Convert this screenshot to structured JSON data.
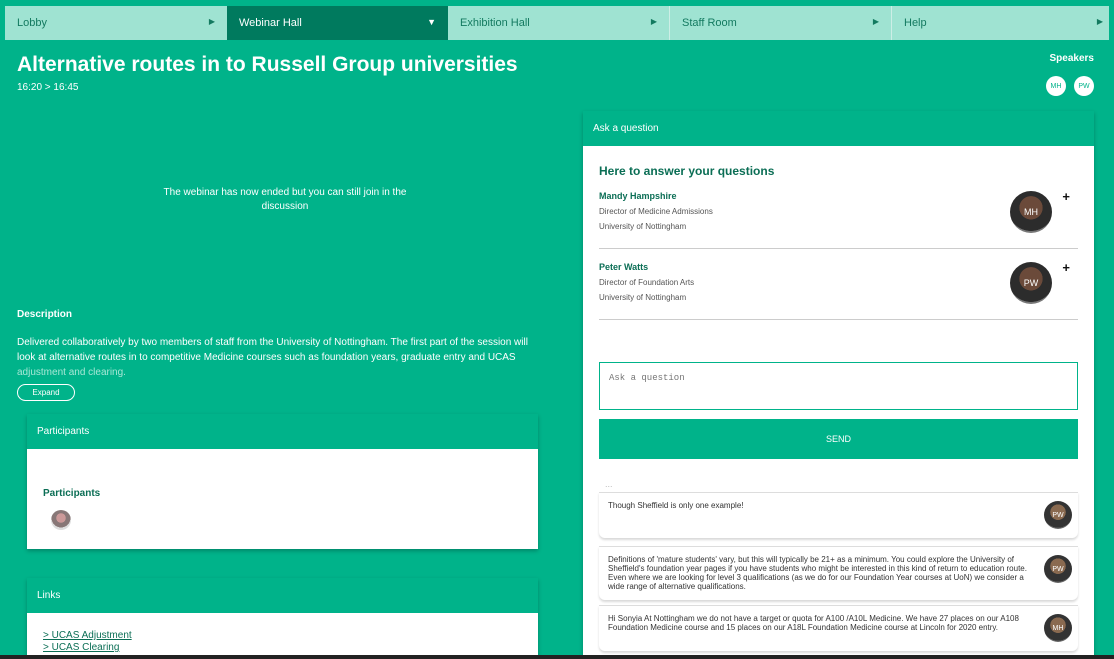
{
  "nav": [
    {
      "label": "Lobby",
      "active": false
    },
    {
      "label": "Webinar Hall",
      "active": true
    },
    {
      "label": "Exhibition Hall",
      "active": false
    },
    {
      "label": "Staff Room",
      "active": false
    },
    {
      "label": "Help",
      "active": false
    }
  ],
  "session": {
    "title": "Alternative routes in to Russell Group universities",
    "time": "16:20 > 16:45",
    "ended_message": "The webinar has now ended but you can still join in the discussion"
  },
  "speakers_header": {
    "label": "Speakers",
    "initials": [
      "MH",
      "PW"
    ]
  },
  "description": {
    "heading": "Description",
    "text": "Delivered collaboratively by two members of staff from the University of Nottingham. The first part of the session will look at alternative routes in to competitive Medicine courses such as foundation years, graduate entry and UCAS",
    "faded_text": "adjustment and clearing.",
    "expand_label": "Expand"
  },
  "participants_panel": {
    "header": "Participants",
    "label": "Participants"
  },
  "links_panel": {
    "header": "Links",
    "items": [
      "> UCAS Adjustment",
      "> UCAS Clearing"
    ]
  },
  "qa": {
    "header": "Ask a question",
    "heading": "Here to answer your questions",
    "speakers": [
      {
        "name": "Mandy Hampshire",
        "role": "Director of Medicine Admissions",
        "org": "University of Nottingham",
        "initials": "MH"
      },
      {
        "name": "Peter Watts",
        "role": "Director of Foundation Arts",
        "org": "University of Nottingham",
        "initials": "PW"
      }
    ],
    "plus": "+",
    "input_placeholder": "Ask a question",
    "send_label": "SEND",
    "loading": "...",
    "messages": [
      {
        "text": "Though Sheffield is only one example!",
        "initials": "PW"
      },
      {
        "text": "Definitions of 'mature students' vary, but this will typically be 21+ as a minimum. You could explore the University of Sheffield's foundation year pages if you have students who might be interested in this kind of return to education route. Even where we are looking for level 3 qualifications (as we do for our Foundation Year courses at UoN) we consider a wide range of alternative qualifications.",
        "initials": "PW"
      },
      {
        "text": "Hi Sonyia At Nottingham we do not have a target or quota for A100 /A10L Medicine. We have 27 places on our A108 Foundation Medicine course and 15 places on our A18L Foundation Medicine course at Lincoln for 2020 entry.",
        "initials": "MH"
      }
    ]
  },
  "colors": {
    "accent": "#00b38a",
    "dark_accent": "#007a5e",
    "nav_bg": "#9fe3d2"
  }
}
